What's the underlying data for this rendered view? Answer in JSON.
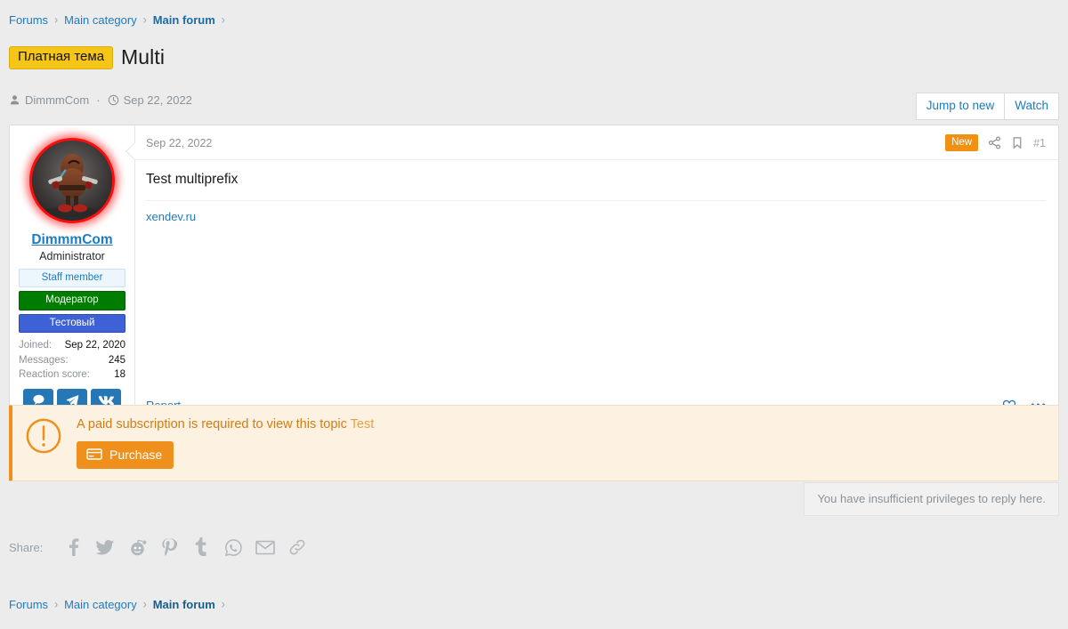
{
  "breadcrumb_top": {
    "items": [
      {
        "label": "Forums",
        "bold": false
      },
      {
        "label": "Main category",
        "bold": false
      },
      {
        "label": "Main forum",
        "bold": true
      }
    ],
    "separator": "›"
  },
  "breadcrumb_bottom": {
    "items": [
      {
        "label": "Forums",
        "bold": false
      },
      {
        "label": "Main category",
        "bold": false
      },
      {
        "label": "Main forum",
        "bold": true
      }
    ],
    "separator": "›"
  },
  "thread": {
    "prefix": "Платная тема",
    "title": "Multi",
    "author": "DimmmCom",
    "separator": "·",
    "date": "Sep 22, 2022",
    "prefix_bg": "#f5c518",
    "prefix_color": "#111111"
  },
  "thread_actions": {
    "jump_to_new": "Jump to new",
    "watch": "Watch"
  },
  "post": {
    "date": "Sep 22, 2022",
    "new_badge": "New",
    "post_number": "#1",
    "body_title": "Test multiprefix",
    "body_link": "xendev.ru",
    "report": "Report"
  },
  "user": {
    "name": "DimmmCom",
    "title": "Administrator",
    "badges": [
      {
        "label": "Staff member",
        "style": "staff"
      },
      {
        "label": "Модератор",
        "style": "mod"
      },
      {
        "label": "Тестовый",
        "style": "test"
      }
    ],
    "stats": [
      {
        "key": "Joined:",
        "value": "Sep 22, 2020"
      },
      {
        "key": "Messages:",
        "value": "245"
      },
      {
        "key": "Reaction score:",
        "value": "18"
      }
    ],
    "social": [
      {
        "icon": "chat-bubble-icon"
      },
      {
        "icon": "telegram-icon"
      },
      {
        "icon": "vk-icon"
      }
    ]
  },
  "notice": {
    "message": "A paid subscription is required to view this topic",
    "topic_name": "Test",
    "purchase_label": "Purchase",
    "accent_color": "#ef8f1c",
    "background": "#fdf1e2"
  },
  "reply_notice": {
    "text": "You have insufficient privileges to reply here."
  },
  "share": {
    "label": "Share:",
    "icons": [
      "facebook-icon",
      "twitter-icon",
      "reddit-icon",
      "pinterest-icon",
      "tumblr-icon",
      "whatsapp-icon",
      "email-icon",
      "link-icon"
    ]
  }
}
